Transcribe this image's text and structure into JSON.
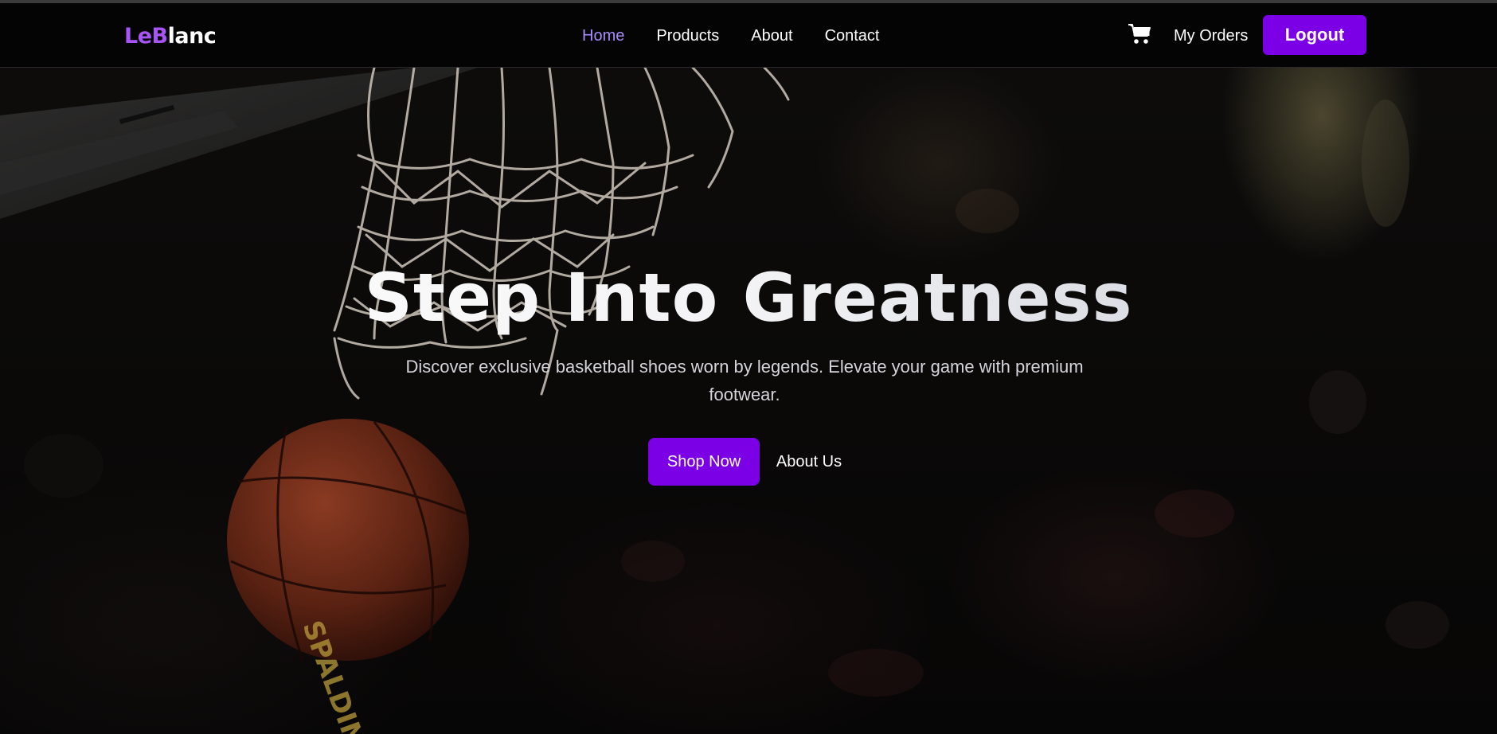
{
  "brand": {
    "logo_part1": "LeB",
    "logo_part2": "lanc"
  },
  "nav": {
    "links": [
      {
        "label": "Home",
        "active": true
      },
      {
        "label": "Products",
        "active": false
      },
      {
        "label": "About",
        "active": false
      },
      {
        "label": "Contact",
        "active": false
      }
    ],
    "cart_icon": "cart-icon",
    "orders_label": "My Orders",
    "logout_label": "Logout"
  },
  "hero": {
    "headline": "Step Into Greatness",
    "subtitle": "Discover exclusive basketball shoes worn by legends. Elevate your game with premium footwear.",
    "primary_cta": "Shop Now",
    "secondary_cta": "About Us",
    "ball_brand_text": "SPALDING"
  },
  "colors": {
    "accent": "#7c00e6",
    "logo_accent": "#a855f7",
    "active_link": "#a78bfa",
    "background": "#060606"
  }
}
